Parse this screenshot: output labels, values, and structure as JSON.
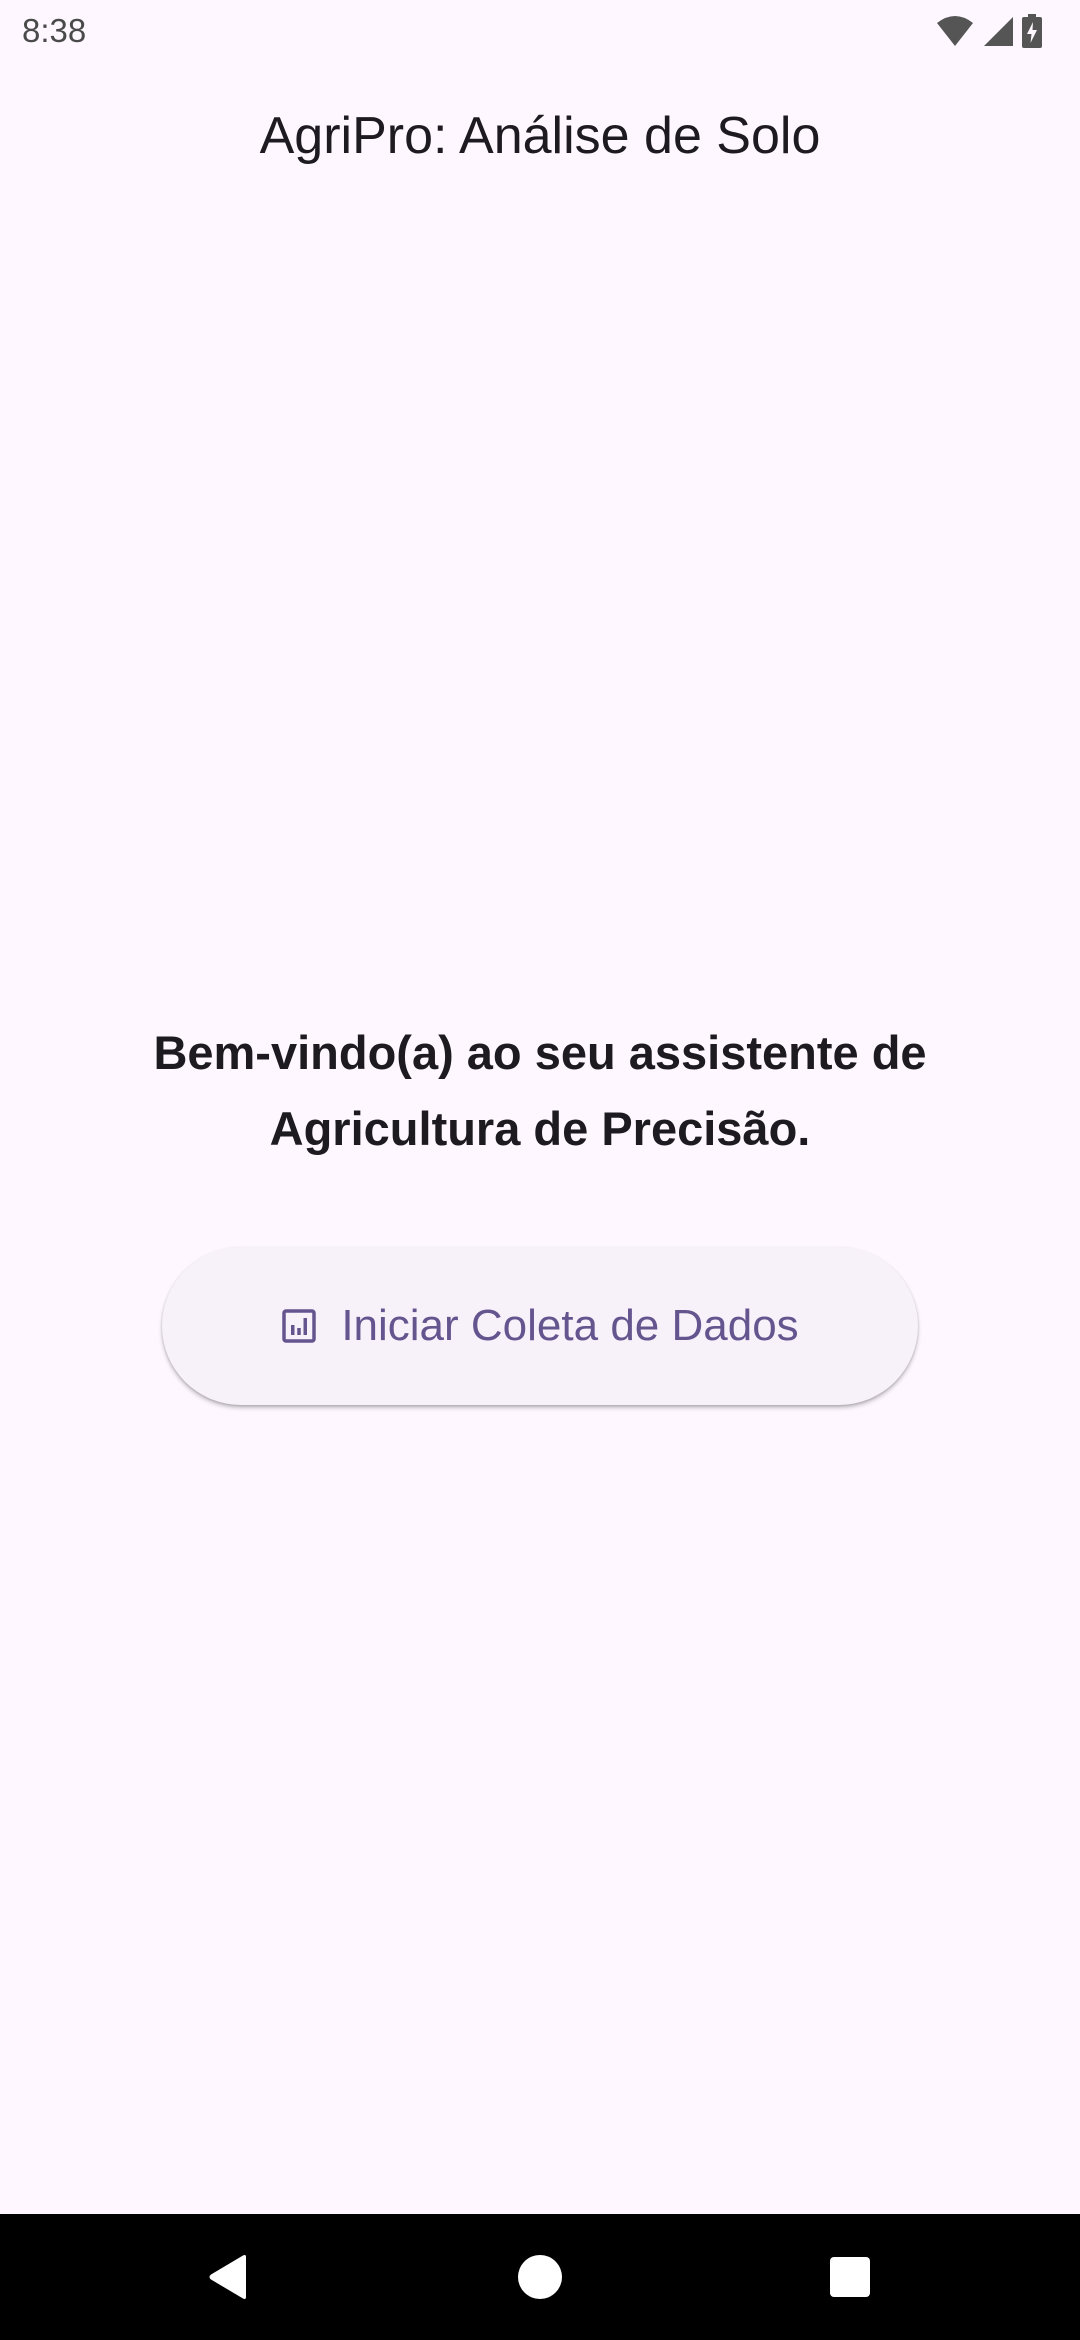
{
  "status_bar": {
    "time": "8:38",
    "icons": [
      "wifi-icon",
      "cell-signal-icon",
      "battery-charging-icon"
    ]
  },
  "app_bar": {
    "title": "AgriPro: Análise de Solo"
  },
  "main": {
    "welcome_text": "Bem-vindo(a) ao seu assistente de Agricultura de Precisão.",
    "start_button": {
      "icon": "bar-chart-icon",
      "label": "Iniciar Coleta de Dados"
    }
  },
  "nav_bar": {
    "buttons": [
      "back-icon",
      "home-icon",
      "recents-icon"
    ]
  },
  "colors": {
    "background": "#FEF7FF",
    "primary": "#65558F",
    "on_surface": "#1D1B20",
    "button_surface": "#F7F2FA"
  }
}
